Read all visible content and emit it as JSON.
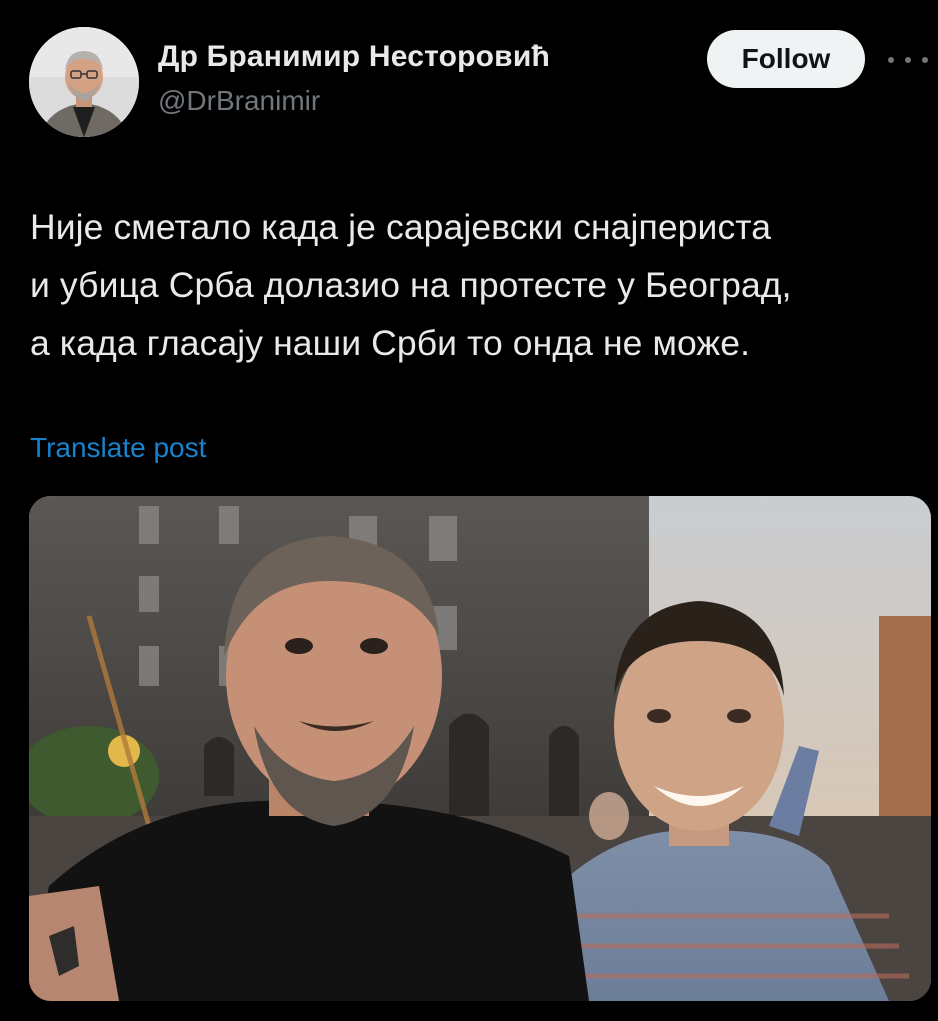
{
  "author": {
    "display_name": "Др Бранимир Несторовић",
    "handle": "@DrBranimir",
    "avatar_icon": "profile-photo"
  },
  "actions": {
    "follow_label": "Follow",
    "more_icon": "more-horizontal-icon"
  },
  "post": {
    "text": "Није сметало када је сарајевски снајпериста\nи убица Срба долазио на протесте у Београд,\nа када гласају наши Срби то онда не може.",
    "translate_label": "Translate post",
    "media_description": "photo"
  },
  "colors": {
    "background": "#000000",
    "primary_text": "#e7e9ea",
    "secondary_text": "#71767b",
    "link": "#1d9bf0",
    "follow_bg": "#eff3f4"
  }
}
